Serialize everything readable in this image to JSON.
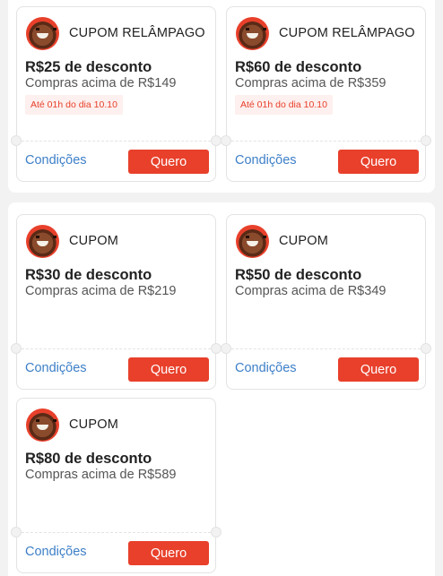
{
  "sections": [
    {
      "cards": [
        {
          "kind": "CUPOM RELÂMPAGO",
          "title": "R$25 de desconto",
          "subtitle": "Compras acima de R$149",
          "badge": "Até 01h do dia 10.10",
          "conditions": "Condições",
          "action": "Quero"
        },
        {
          "kind": "CUPOM RELÂMPAGO",
          "title": "R$60 de desconto",
          "subtitle": "Compras acima de R$359",
          "badge": "Até 01h do dia 10.10",
          "conditions": "Condições",
          "action": "Quero"
        }
      ]
    },
    {
      "cards": [
        {
          "kind": "CUPOM",
          "title": "R$30 de desconto",
          "subtitle": "Compras acima de R$219",
          "conditions": "Condições",
          "action": "Quero"
        },
        {
          "kind": "CUPOM",
          "title": "R$50 de desconto",
          "subtitle": "Compras acima de R$349",
          "conditions": "Condições",
          "action": "Quero"
        },
        {
          "kind": "CUPOM",
          "title": "R$80 de desconto",
          "subtitle": "Compras acima de R$589",
          "conditions": "Condições",
          "action": "Quero"
        }
      ]
    }
  ],
  "colors": {
    "accent": "#e8402b",
    "link": "#3d7fc7",
    "badge_bg": "#fdf0ee"
  },
  "icons": {
    "avatar": "mascot-avatar-icon"
  }
}
